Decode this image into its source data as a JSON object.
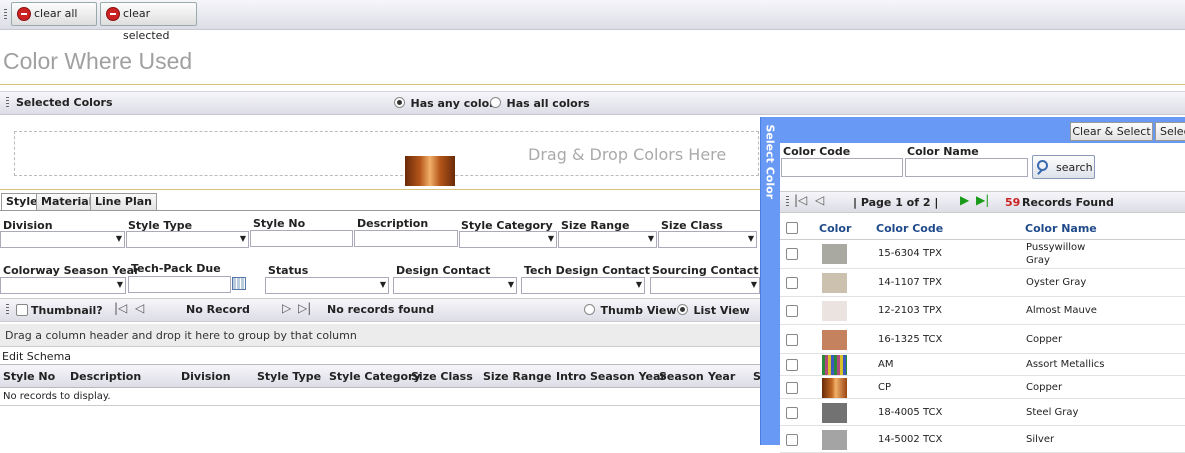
{
  "toolbar": {
    "clear_all": "clear all",
    "clear_selected": "clear selected"
  },
  "page": {
    "title": "Color Where Used"
  },
  "selected_colors": {
    "label": "Selected Colors",
    "radio_any": "Has any color",
    "radio_all": "Has all colors",
    "drop_hint": "Drag & Drop Colors Here"
  },
  "tabs": [
    "Style",
    "Material",
    "Line Plan"
  ],
  "filters": {
    "division": "Division",
    "style_type": "Style Type",
    "style_no": "Style No",
    "description": "Description",
    "style_category": "Style Category",
    "size_range": "Size Range",
    "size_class": "Size Class",
    "colorway_season_year": "Colorway Season Year",
    "techpack_due": "Tech-Pack Due",
    "status": "Status",
    "design_contact": "Design Contact",
    "tech_design_contact": "Tech Design Contact",
    "sourcing_contact": "Sourcing Contact"
  },
  "results_toolbar": {
    "thumbnail": "Thumbnail?",
    "no_record": "No Record",
    "no_records_found": "No records found",
    "thumb_view": "Thumb View",
    "list_view": "List View"
  },
  "grid": {
    "group_hint": "Drag a column header and drop it here to group by that column",
    "edit_schema": "Edit Schema",
    "columns": [
      "Style No",
      "Description",
      "Division",
      "Style Type",
      "Style Category",
      "Size Class",
      "Size Range",
      "Intro Season Year",
      "Season",
      "Year",
      "S"
    ],
    "empty": "No records to display."
  },
  "select_color": {
    "side_label": "Select Color",
    "clear_select": "Clear & Select",
    "select": "Selec",
    "color_code_label": "Color Code",
    "color_name_label": "Color Name",
    "search": "search",
    "page_info": "| Page 1 of 2 |",
    "records_count": "59",
    "records_label": "Records Found",
    "col_color": "Color",
    "col_code": "Color Code",
    "col_name": "Color Name",
    "rows": [
      {
        "code": "15-6304 TPX",
        "name": "Pussywillow",
        "name2": "Gray",
        "swatch": "#a9a9a1"
      },
      {
        "code": "14-1107 TPX",
        "name": "Oyster Gray",
        "name2": "",
        "swatch": "#cbc1ae"
      },
      {
        "code": "12-2103 TPX",
        "name": "Almost Mauve",
        "name2": "",
        "swatch": "#ebe3df"
      },
      {
        "code": "16-1325 TCX",
        "name": "Copper",
        "name2": "",
        "swatch": "#c5825e"
      },
      {
        "code": "AM",
        "name": "Assort Metallics",
        "name2": "",
        "swatch": "#b04a7a"
      },
      {
        "code": "CP",
        "name": "Copper",
        "name2": "",
        "swatch": "#b0561f"
      },
      {
        "code": "18-4005 TCX",
        "name": "Steel Gray",
        "name2": "",
        "swatch": "#727272"
      },
      {
        "code": "14-5002 TCX",
        "name": "Silver",
        "name2": "",
        "swatch": "#a4a4a4"
      }
    ]
  }
}
